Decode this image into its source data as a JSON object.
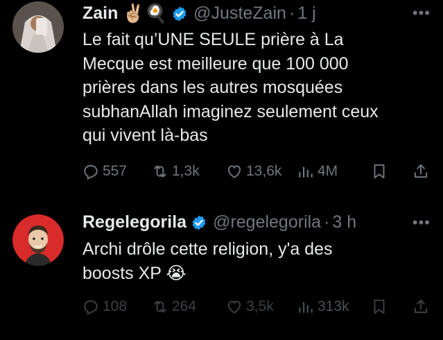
{
  "tweets": [
    {
      "name": "Zain",
      "name_emojis": "✌🏼🍳",
      "handle": "@JusteZain",
      "time": "1 j",
      "text": "Le fait qu’UNE SEULE prière à La\nMecque est meilleure que 100 000\nprières dans les autres mosquées\nsubhanAllah imaginez seulement ceux\nqui vivent là-bas",
      "replies": "557",
      "retweets": "1,3k",
      "likes": "13,6k",
      "views": "4M"
    },
    {
      "name": "Regelegorila",
      "handle": "@regelegorila",
      "time": "3 h",
      "text": "Archi drôle cette religion, y'a des\nboosts XP 😭",
      "replies": "108",
      "retweets": "264",
      "likes": "3,5k",
      "views": "313k"
    }
  ],
  "more_label": "•••",
  "icons": {
    "verified": "verified-badge-icon",
    "reply": "reply-icon",
    "retweet": "retweet-icon",
    "like": "heart-icon",
    "views": "views-icon",
    "bookmark": "bookmark-icon",
    "share": "share-icon"
  },
  "colors": {
    "background": "#000000",
    "text": "#e7e9ea",
    "muted": "#71767b",
    "verified": "#1d9bf0"
  }
}
